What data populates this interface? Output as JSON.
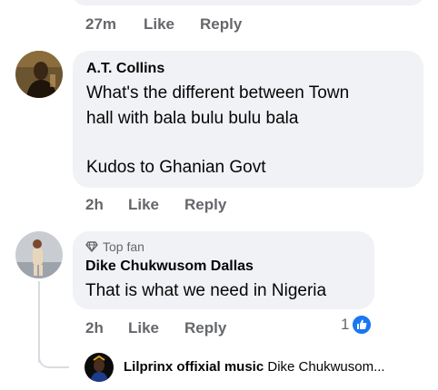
{
  "top_comment": {
    "time": "27m",
    "like_label": "Like",
    "reply_label": "Reply"
  },
  "comments": [
    {
      "author": "A.T. Collins",
      "text_lines": [
        "What's the different between Town",
        "hall with bala bulu bulu bala",
        "",
        "Kudos to Ghanian Govt"
      ],
      "time": "2h",
      "like_label": "Like",
      "reply_label": "Reply"
    },
    {
      "badge_label": "Top fan",
      "author": "Dike Chukwusom Dallas",
      "text_lines": [
        "That is what we need in Nigeria"
      ],
      "time": "2h",
      "like_label": "Like",
      "reply_label": "Reply",
      "reaction_count": "1",
      "reaction_color": "#1877f2"
    }
  ],
  "reply_preview": {
    "author": "Lilprinx offixial music",
    "snippet": "Dike Chukwusom..."
  }
}
